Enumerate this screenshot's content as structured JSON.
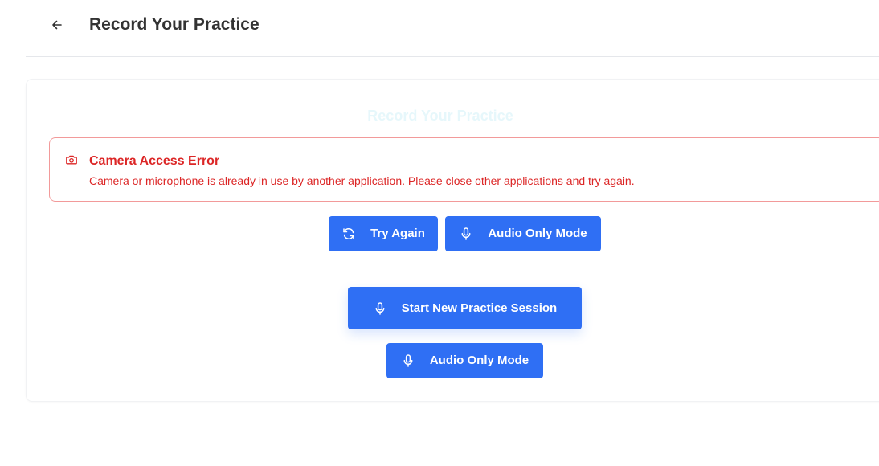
{
  "header": {
    "title": "Record Your Practice",
    "back_icon": "arrow-left-icon"
  },
  "card": {
    "title": "Record Your Practice"
  },
  "alert": {
    "icon": "camera-icon",
    "title": "Camera Access Error",
    "message": "Camera or microphone is already in use by another application. Please close other applications and try again.",
    "color": "#dc2626",
    "border_color": "#f29a9a"
  },
  "actions": {
    "try_again": {
      "label": "Try Again",
      "icon": "refresh-icon"
    },
    "audio_only": {
      "label": "Audio Only Mode",
      "icon": "microphone-icon"
    },
    "start_session": {
      "label": "Start New Practice Session",
      "icon": "microphone-icon"
    },
    "audio_only_secondary": {
      "label": "Audio Only Mode",
      "icon": "microphone-icon"
    }
  },
  "colors": {
    "primary": "#2f6ff4",
    "title_text": "#333333"
  }
}
